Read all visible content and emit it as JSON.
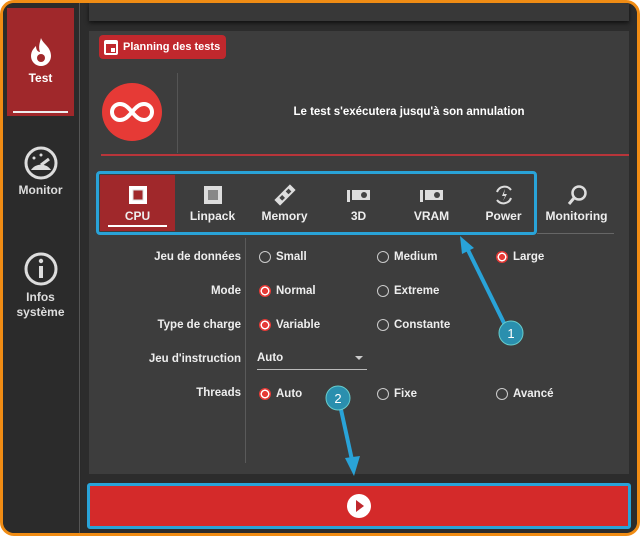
{
  "sidebar": {
    "items": [
      {
        "label": "Test",
        "icon": "flame-icon",
        "active": true
      },
      {
        "label": "Monitor",
        "icon": "gauge-icon"
      },
      {
        "label": "Infos système",
        "icon": "info-icon"
      }
    ]
  },
  "schedule_button": "Planning des tests",
  "duration_icon": "infinity-icon",
  "duration_message": "Le test s'exécutera jusqu'à son annulation",
  "tabs": [
    {
      "label": "CPU",
      "active": true
    },
    {
      "label": "Linpack"
    },
    {
      "label": "Memory"
    },
    {
      "label": "3D"
    },
    {
      "label": "VRAM"
    },
    {
      "label": "Power"
    },
    {
      "label": "Monitoring"
    }
  ],
  "form": {
    "dataset": {
      "label": "Jeu de données",
      "options": [
        "Small",
        "Medium",
        "Large"
      ],
      "selected": "Large"
    },
    "mode": {
      "label": "Mode",
      "options": [
        "Normal",
        "Extreme"
      ],
      "selected": "Normal"
    },
    "load_type": {
      "label": "Type de charge",
      "options": [
        "Variable",
        "Constante"
      ],
      "selected": "Variable"
    },
    "instruction_set": {
      "label": "Jeu d'instruction",
      "value": "Auto"
    },
    "threads": {
      "label": "Threads",
      "options": [
        "Auto",
        "Fixe",
        "Avancé"
      ],
      "selected": "Auto"
    }
  },
  "annotations": [
    "1",
    "2"
  ],
  "colors": {
    "accent": "#a0282b",
    "run": "#d42a2a",
    "highlight": "#29a3d8",
    "frame": "#f08c14"
  }
}
